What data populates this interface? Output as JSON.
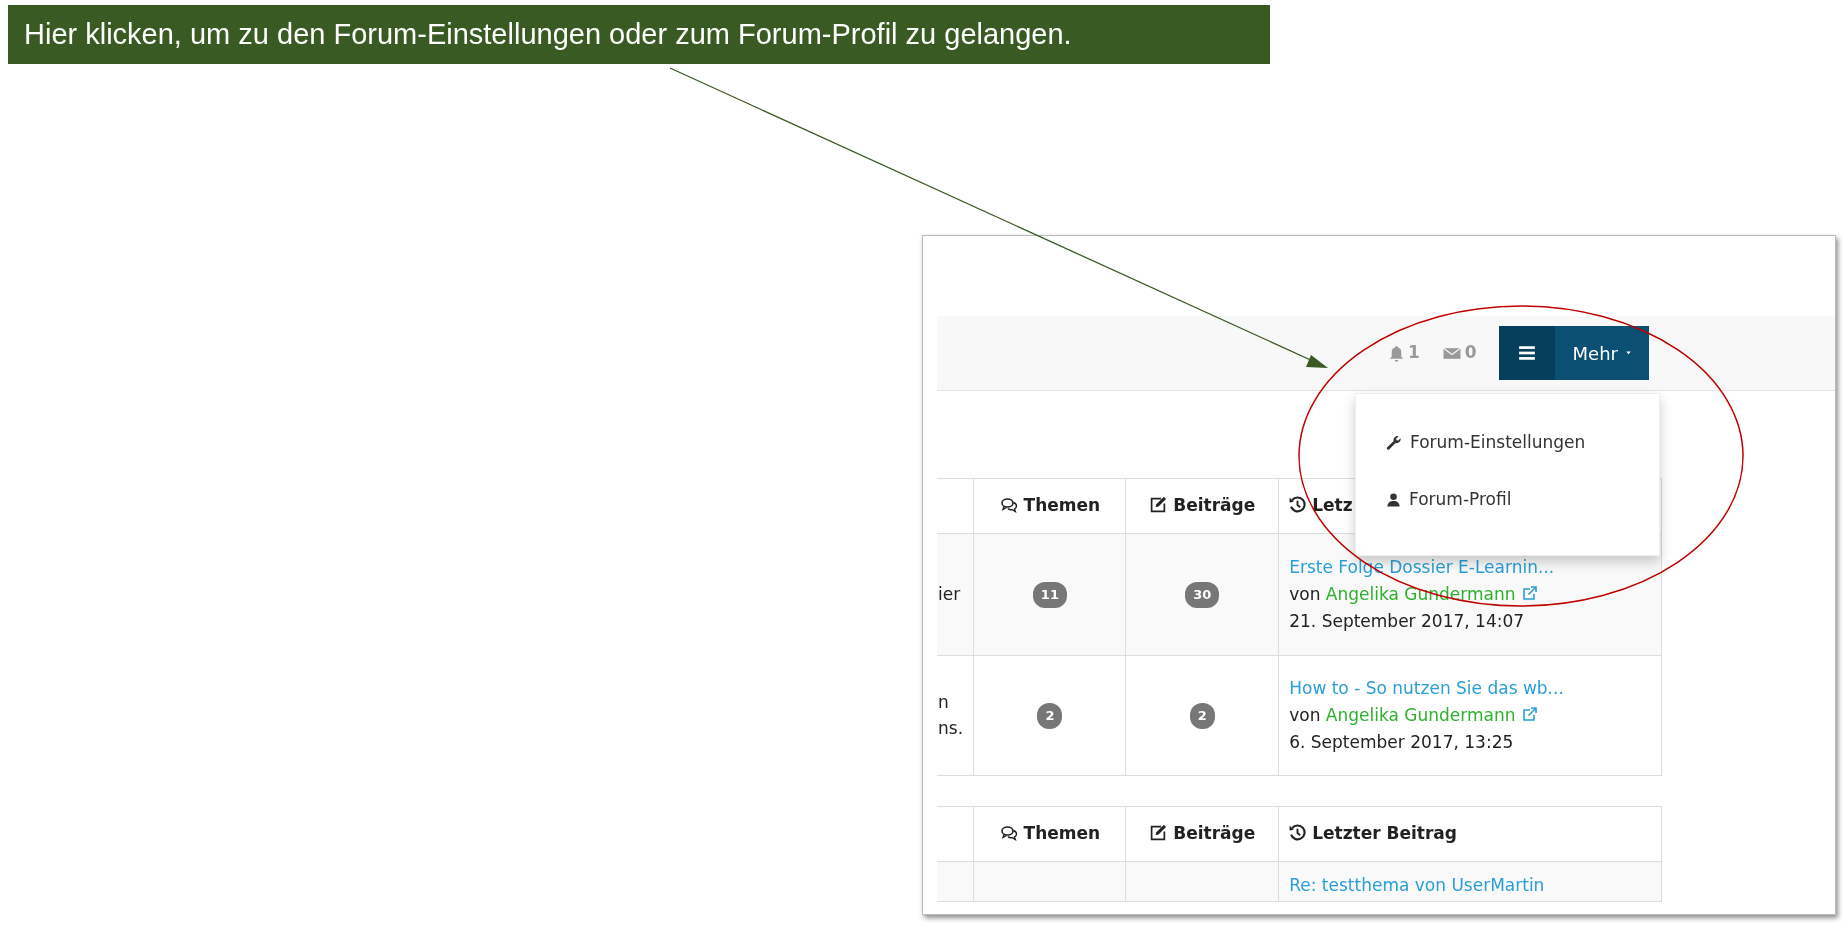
{
  "callout": {
    "text": "Hier klicken, um zu den Forum-Einstellungen oder zum Forum-Profil zu gelangen."
  },
  "toolbar": {
    "notifications": "1",
    "messages": "0",
    "more_button": "Mehr"
  },
  "dropdown": {
    "open": true,
    "items": [
      {
        "kind": "settings",
        "label": "Forum-Einstellungen"
      },
      {
        "kind": "profile",
        "label": "Forum-Profil"
      }
    ]
  },
  "forum_tables": [
    {
      "columns": [
        {
          "kind": "topics",
          "label": "Themen"
        },
        {
          "kind": "posts",
          "label": "Beiträge"
        },
        {
          "kind": "last",
          "label": "Letz"
        }
      ],
      "rows": [
        {
          "column_1": "ier",
          "topics": "11",
          "posts": "30",
          "last_post": {
            "title": "Erste Folge Dossier E-Learnin...",
            "by": "von",
            "author": "Angelika Gundermann",
            "date": "21. September 2017, 14:07"
          }
        },
        {
          "column_1": "n\nns.",
          "topics": "2",
          "posts": "2",
          "last_post": {
            "title": "How to - So nutzen Sie das wb...",
            "by": "von",
            "author": "Angelika Gundermann",
            "date": "6. September 2017, 13:25"
          }
        }
      ]
    },
    {
      "columns": [
        {
          "kind": "topics",
          "label": "Themen"
        },
        {
          "kind": "posts",
          "label": "Beiträge"
        },
        {
          "kind": "last",
          "label": "Letzter Beitrag"
        }
      ],
      "rows": [
        {
          "last_post": {
            "title": "Re: testthema von UserMartin"
          }
        }
      ]
    }
  ]
}
